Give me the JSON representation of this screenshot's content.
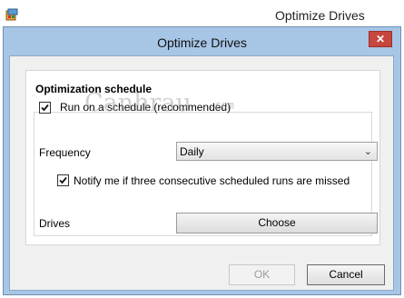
{
  "parent_window": {
    "title": "Optimize Drives",
    "icon": "disk-defrag-app-icon"
  },
  "dialog": {
    "title": "Optimize Drives",
    "close_label": "✕",
    "section_title": "Optimization schedule",
    "run_on_schedule": {
      "label": "Run on a schedule (recommended)",
      "checked": true
    },
    "frequency": {
      "label": "Frequency",
      "value": "Daily"
    },
    "notify": {
      "label": "Notify me if three consecutive scheduled runs are missed",
      "checked": true
    },
    "drives": {
      "label": "Drives",
      "button": "Choose"
    },
    "ok_label": "OK",
    "cancel_label": "Cancel"
  },
  "watermark": {
    "text": "Canhrau",
    "suffix": ".com"
  }
}
